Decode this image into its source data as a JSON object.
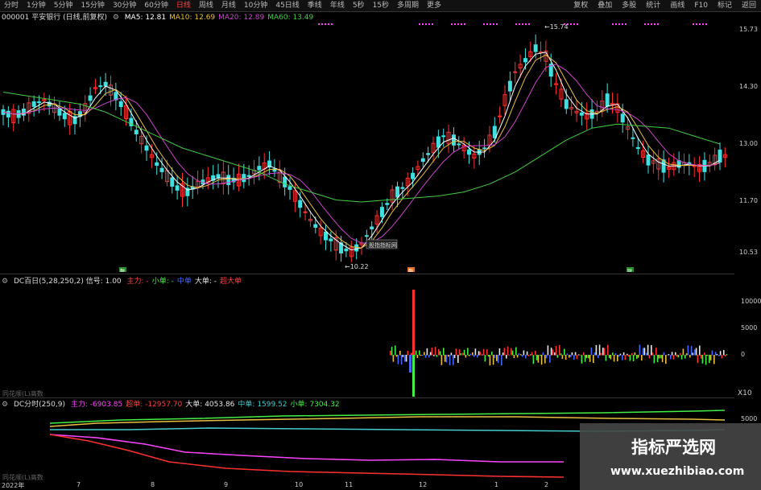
{
  "toolbar": {
    "periods": [
      "分时",
      "1分钟",
      "5分钟",
      "15分钟",
      "30分钟",
      "60分钟",
      "日线",
      "周线",
      "月线",
      "10分钟",
      "45日线",
      "季线",
      "年线",
      "5秒",
      "15秒",
      "多周期",
      "更多"
    ],
    "active_period": "日线",
    "actions": [
      "复权",
      "叠加",
      "多股",
      "统计",
      "画线",
      "F10",
      "标记",
      "返回"
    ]
  },
  "main_pane": {
    "stock": "000001 平安银行 (日线,前复权)",
    "ma": [
      {
        "label": "MA5: 12.81",
        "color": "#ffffff"
      },
      {
        "label": "MA10: 12.69",
        "color": "#e8c040"
      },
      {
        "label": "MA20: 12.89",
        "color": "#cc44cc"
      },
      {
        "label": "MA60: 13.49",
        "color": "#44cc44"
      }
    ],
    "price_axis": [
      "15.73",
      "14.30",
      "13.00",
      "11.70",
      "10.53"
    ],
    "high_label": "15.74",
    "low_label": "10.22",
    "tooltip": "股指指标网",
    "markers": [
      "融",
      "融",
      "财"
    ]
  },
  "pane2": {
    "title": "DC百日(5,28,250,2) 信号: 1.00",
    "legend": [
      {
        "label": "主力: -",
        "color": "#ff4040"
      },
      {
        "label": "小单: -",
        "color": "#44ee44"
      },
      {
        "label": "中单",
        "color": "#4466ff"
      },
      {
        "label": "大单: -",
        "color": "#e8e8e8"
      },
      {
        "label": "超大单",
        "color": "#ff4040"
      }
    ],
    "axis": [
      "10000",
      "5000",
      "0"
    ],
    "corner": "X10",
    "watermark": "同花顺(L)高数"
  },
  "pane3": {
    "title": "DC分时(250,9)",
    "legend": [
      {
        "label": "主力: -6903.85",
        "color": "#ff44ff"
      },
      {
        "label": "超单: -12957.70",
        "color": "#ff4040"
      },
      {
        "label": "大单: 4053.86",
        "color": "#e8e8e8"
      },
      {
        "label": "中单: 1599.52",
        "color": "#44cccc"
      },
      {
        "label": "小单: 7304.32",
        "color": "#44ee44"
      }
    ],
    "axis": [
      "5000"
    ],
    "watermark": "同花顺(L)高数"
  },
  "xaxis": [
    "2022年",
    "7",
    "8",
    "9",
    "10",
    "11",
    "12",
    "1",
    "2"
  ],
  "watermark": {
    "title": "指标严选网",
    "url": "www.xuezhibiao.com"
  }
}
